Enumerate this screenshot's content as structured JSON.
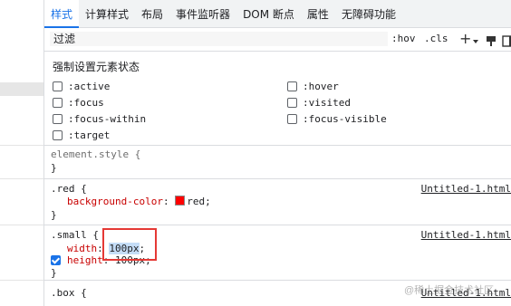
{
  "tabs": [
    {
      "label": "样式",
      "active": true
    },
    {
      "label": "计算样式",
      "active": false
    },
    {
      "label": "布局",
      "active": false
    },
    {
      "label": "事件监听器",
      "active": false
    },
    {
      "label": "DOM 断点",
      "active": false
    },
    {
      "label": "属性",
      "active": false
    },
    {
      "label": "无障碍功能",
      "active": false
    }
  ],
  "filter": {
    "placeholder": "过滤",
    "hov": ":hov",
    "cls": ".cls",
    "plus": "+"
  },
  "state_panel": {
    "title": "强制设置元素状态",
    "left": [
      ":active",
      ":focus",
      ":focus-within",
      ":target"
    ],
    "right": [
      ":hover",
      ":visited",
      ":focus-visible"
    ]
  },
  "rules": {
    "element_style": {
      "selector": "element.style {",
      "close": "}"
    },
    "red": {
      "selector": ".red {",
      "source": "Untitled-1.html",
      "prop": "background-color",
      "colon": ":",
      "value": "red",
      "semi": ";",
      "close": "}",
      "swatch_color": "#ff0000"
    },
    "small": {
      "selector": ".small {",
      "source": "Untitled-1.html",
      "prop1": "width",
      "colon1": ":",
      "value1": "100px",
      "semi1": ";",
      "prop2": "height",
      "colon2": ":",
      "value2": "100px",
      "semi2": ";",
      "close": "}"
    },
    "box": {
      "selector": ".box {",
      "source": "Untitled-1.html"
    }
  },
  "watermark": "@稀土掘金技术社区",
  "colors": {
    "accent": "#1a73e8",
    "prop": "#c80000",
    "highlight": "#e53935"
  }
}
